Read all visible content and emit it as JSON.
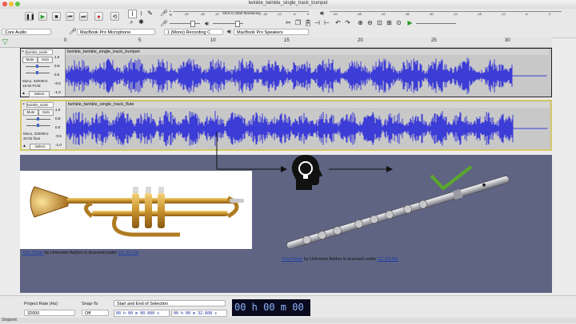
{
  "window": {
    "title": "twinkle_twinkle_single_track_trumpet"
  },
  "toolbar": {
    "transport": [
      "❚❚",
      "▶",
      "■",
      "⏮",
      "⏭",
      "●",
      "⟲"
    ],
    "meter_hint": "Click to Start Monitoring",
    "meter_ticks_top": [
      "-54",
      "-48",
      "-42",
      "-18",
      "-12",
      "-6",
      "0"
    ],
    "meter_ticks_right": [
      "-54",
      "-48",
      "-42",
      "-36",
      "-30",
      "-24",
      "-18",
      "-12",
      "-6",
      "0"
    ],
    "rec_channel_L": "L",
    "rec_channel_R": "R"
  },
  "devices": {
    "host": "Core Audio",
    "mic": "MacBook Pro Microphone",
    "channels": "1 (Mono) Recording C",
    "speaker": "MacBook Pro Speakers"
  },
  "ruler": {
    "ticks": [
      "0",
      "5",
      "10",
      "15",
      "20",
      "25",
      "30"
    ]
  },
  "tracks": [
    {
      "name": "twinkle_twink",
      "clip": "twinkle_twinkle_single_track_trumpet",
      "mute": "Mute",
      "solo": "Solo",
      "format1": "Mono, 32000Hz",
      "format2": "16-bit PCM",
      "select": "Select",
      "scale": [
        "1.0",
        "0.5-",
        "0.0",
        "-0.5",
        "-1.0"
      ]
    },
    {
      "name": "twinkle_twink",
      "clip": "twinkle_twinkle_single_track_flute",
      "mute": "Mute",
      "solo": "Solo",
      "format1": "Mono, 32000Hz",
      "format2": "32-bit float",
      "select": "Select",
      "scale": [
        "1.0",
        "0.5-",
        "0.0",
        "-0.5",
        "-1.0"
      ]
    }
  ],
  "captions": {
    "trumpet": {
      "link1": "This Photo",
      "mid": " by Unknown Author is licensed under ",
      "link2": "CC BY-SA"
    },
    "flute": {
      "link1": "This Photo",
      "mid": " by Unknown Author is licensed under ",
      "link2": "CC BY-NC"
    }
  },
  "bottom": {
    "project_rate_label": "Project Rate (Hz)",
    "project_rate_value": "32000",
    "snap_label": "Snap-To",
    "snap_value": "Off",
    "selection_mode": "Start and End of Selection",
    "sel_start": "00 h 00 m 00.000 s",
    "sel_end": "00 h 00 m 32.608 s",
    "position": "00 h 00 m 00 s"
  },
  "status": "Stopped.",
  "colors": {
    "waveform": "#3c3cd6",
    "check": "#5aa82a",
    "panel": "#5f6482",
    "track_border": "#1a1a1a"
  }
}
